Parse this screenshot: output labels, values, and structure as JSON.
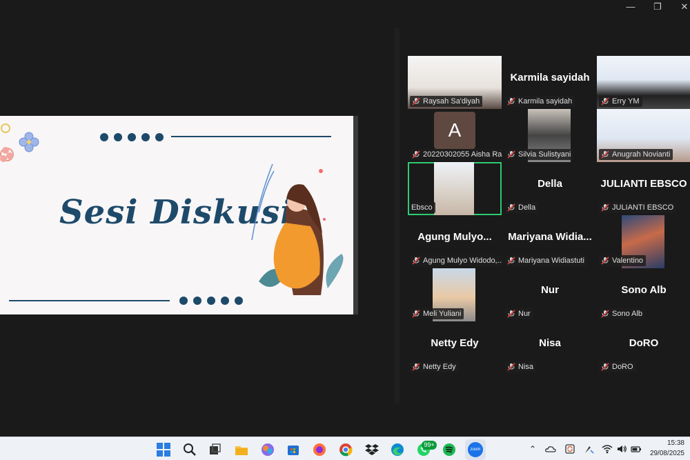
{
  "window": {
    "minimize_label": "—",
    "restore_label": "❐",
    "close_label": "✕"
  },
  "slide": {
    "title": "Sesi Diskusi"
  },
  "participants": [
    {
      "label": "Raysah Sa'diyah",
      "name": "",
      "kind": "video"
    },
    {
      "label": "Karmila sayidah",
      "name": "Karmila sayidah",
      "kind": "name"
    },
    {
      "label": "Erry YM",
      "name": "",
      "kind": "video"
    },
    {
      "label": "20220302055 Aisha Ra...",
      "name": "",
      "kind": "avatar",
      "avatar_letter": "A"
    },
    {
      "label": "Silvia Sulistyani",
      "name": "",
      "kind": "video"
    },
    {
      "label": "Anugrah Novianti",
      "name": "",
      "kind": "video"
    },
    {
      "label": "Ebsco",
      "name": "",
      "kind": "video",
      "active": true
    },
    {
      "label": "Della",
      "name": "Della",
      "kind": "name"
    },
    {
      "label": "JULIANTI EBSCO",
      "name": "JULIANTI EBSCO",
      "kind": "name"
    },
    {
      "label": "Agung Mulyo Widodo,...",
      "name": "Agung  Mulyo...",
      "kind": "name"
    },
    {
      "label": "Mariyana Widiastuti",
      "name": "Mariyana  Widia...",
      "kind": "name"
    },
    {
      "label": "Valentino",
      "name": "",
      "kind": "video"
    },
    {
      "label": "Meli Yuliani",
      "name": "",
      "kind": "video"
    },
    {
      "label": "Nur",
      "name": "Nur",
      "kind": "name"
    },
    {
      "label": "Sono Alb",
      "name": "Sono Alb",
      "kind": "name"
    },
    {
      "label": "Netty Edy",
      "name": "Netty Edy",
      "kind": "name"
    },
    {
      "label": "Nisa",
      "name": "Nisa",
      "kind": "name"
    },
    {
      "label": "DoRO",
      "name": "DoRO",
      "kind": "name"
    }
  ],
  "taskbar": {
    "time": "15:38",
    "date": "29/08/2025",
    "whatsapp_badge": "99+",
    "zoom_icon_text": "zoom"
  },
  "colors": {
    "slide_accent": "#1e4a6a",
    "active_speaker": "#2ecc71",
    "mic_muted": "#e0413f"
  }
}
